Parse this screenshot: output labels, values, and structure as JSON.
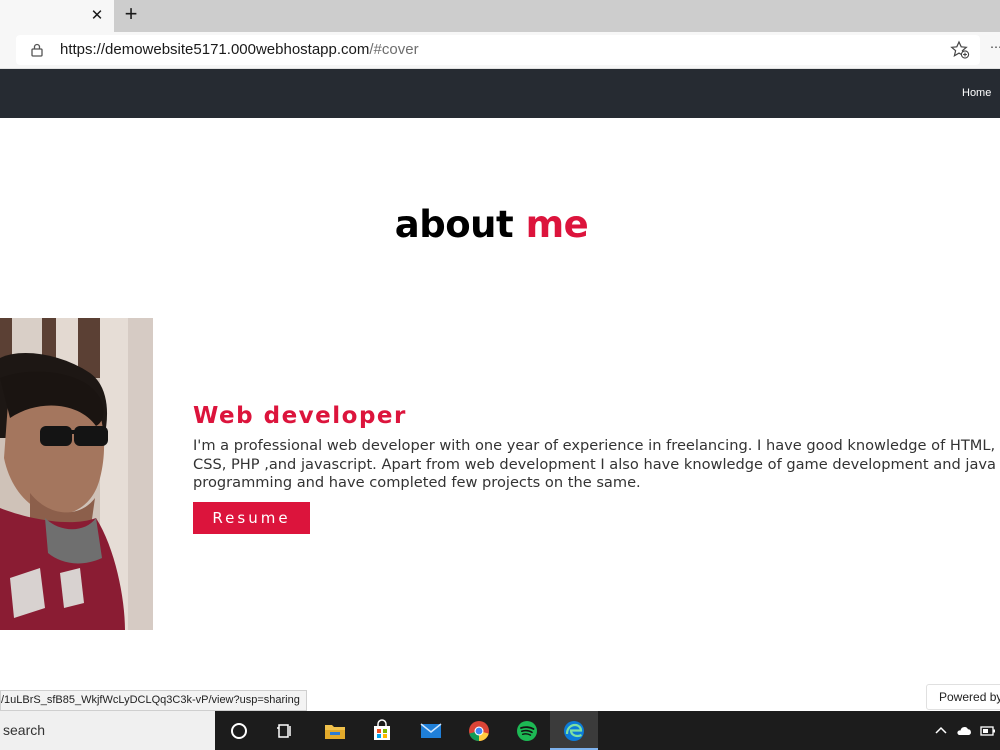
{
  "browser": {
    "tab_close_glyph": "✕",
    "new_tab_glyph": "+",
    "url_main": "https://demowebsite5171.000webhostapp.com",
    "url_tail": "/#cover",
    "more_glyph": "⋯"
  },
  "site": {
    "nav": {
      "home_label": "Home"
    },
    "about": {
      "title_main": "about",
      "title_accent": "me"
    },
    "role": "Web developer",
    "bio": "I'm a professional web developer with one year of experience in freelancing. I have good knowledge of HTML, CSS, PHP ,and javascript. Apart from web development I also have knowledge of game development and java programming and have completed few projects on the same.",
    "resume_label": "Resume",
    "accent_color": "#dc143c",
    "navbar_color": "#262b32"
  },
  "status_bar": {
    "link_preview": "/1uLBrS_sfB85_WkjfWcLyDCLQq3C3k-vP/view?usp=sharing",
    "powered_label": "Powered by"
  },
  "taskbar": {
    "search_label": "search",
    "icons": [
      "cortana-icon",
      "task-view-icon",
      "file-explorer-icon",
      "microsoft-store-icon",
      "mail-icon",
      "chrome-icon",
      "spotify-icon",
      "edge-icon"
    ],
    "tray_icons": [
      "chevron-up-icon",
      "onedrive-icon",
      "battery-icon"
    ]
  }
}
